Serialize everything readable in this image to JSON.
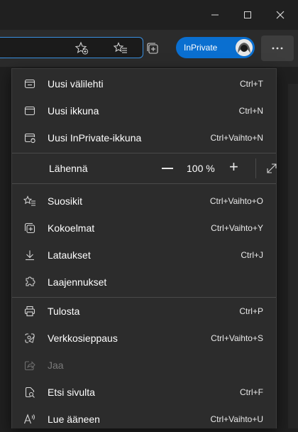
{
  "browser": {
    "inprivate_label": "InPrivate"
  },
  "menu": {
    "group1": [
      {
        "label": "Uusi välilehti",
        "shortcut": "Ctrl+T",
        "icon": "new-tab-icon"
      },
      {
        "label": "Uusi ikkuna",
        "shortcut": "Ctrl+N",
        "icon": "new-window-icon"
      },
      {
        "label": "Uusi InPrivate-ikkuna",
        "shortcut": "Ctrl+Vaihto+N",
        "icon": "inprivate-window-icon"
      }
    ],
    "zoom": {
      "label": "Lähennä",
      "value": "100 %"
    },
    "group2": [
      {
        "label": "Suosikit",
        "shortcut": "Ctrl+Vaihto+O",
        "icon": "favorites-icon"
      },
      {
        "label": "Kokoelmat",
        "shortcut": "Ctrl+Vaihto+Y",
        "icon": "collections-icon"
      },
      {
        "label": "Lataukset",
        "shortcut": "Ctrl+J",
        "icon": "download-icon"
      },
      {
        "label": "Laajennukset",
        "shortcut": "",
        "icon": "extensions-icon"
      }
    ],
    "group3": [
      {
        "label": "Tulosta",
        "shortcut": "Ctrl+P",
        "icon": "print-icon"
      },
      {
        "label": "Verkkosieppaus",
        "shortcut": "Ctrl+Vaihto+S",
        "icon": "web-capture-icon"
      },
      {
        "label": "Jaa",
        "shortcut": "",
        "icon": "share-icon",
        "disabled": true
      },
      {
        "label": "Etsi sivulta",
        "shortcut": "Ctrl+F",
        "icon": "find-on-page-icon"
      },
      {
        "label": "Lue ääneen",
        "shortcut": "Ctrl+Vaihto+U",
        "icon": "read-aloud-icon"
      }
    ]
  },
  "colors": {
    "accent": "#0a6fd0",
    "menu_bg": "#2c2c2c",
    "titlebar_bg": "#202020"
  }
}
